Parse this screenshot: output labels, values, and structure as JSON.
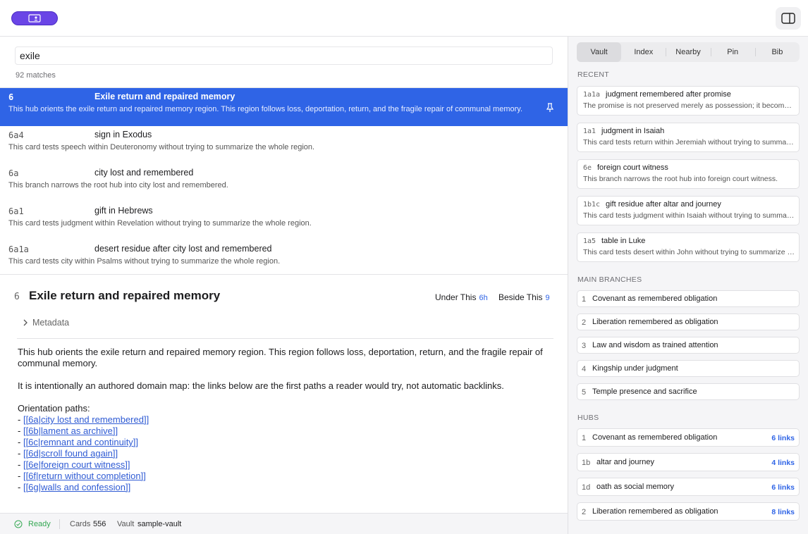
{
  "search": {
    "value": "exile",
    "match_count": "92 matches"
  },
  "results": [
    {
      "id": "6",
      "title": "Exile return and repaired memory",
      "desc": "This hub orients the exile return and repaired memory region. This region follows loss, deportation, return, and the fragile repair of communal memory.",
      "selected": true
    },
    {
      "id": "6a4",
      "title": "sign in Exodus",
      "desc": "This card tests speech within Deuteronomy without trying to summarize the whole region."
    },
    {
      "id": "6a",
      "title": "city lost and remembered",
      "desc": "This branch narrows the root hub into city lost and remembered."
    },
    {
      "id": "6a1",
      "title": "gift in Hebrews",
      "desc": "This card tests judgment within Revelation without trying to summarize the whole region."
    },
    {
      "id": "6a1a",
      "title": "desert residue after city lost and remembered",
      "desc": "This card tests city within Psalms without trying to summarize the whole region."
    }
  ],
  "detail": {
    "id": "6",
    "title": "Exile return and repaired memory",
    "under_label": "Under This",
    "under_count": "6h",
    "beside_label": "Beside This",
    "beside_count": "9",
    "metadata_label": "Metadata",
    "para1": "This hub orients the exile return and repaired memory region. This region follows loss, deportation, return, and the fragile repair of communal memory.",
    "para2": "It is intentionally an authored domain map: the links below are the first paths a reader would try, not automatic backlinks.",
    "paths_label": "Orientation paths:",
    "paths": [
      "[[6a|city lost and remembered]]",
      "[[6b|lament as archive]]",
      "[[6c|remnant and continuity]]",
      "[[6d|scroll found again]]",
      "[[6e|foreign court witness]]",
      "[[6f|return without completion]]",
      "[[6g|walls and confession]]"
    ]
  },
  "status": {
    "state": "Ready",
    "cards_label": "Cards",
    "cards_count": "556",
    "vault_label": "Vault",
    "vault_name": "sample-vault"
  },
  "sidebar": {
    "tabs": [
      "Vault",
      "Index",
      "Nearby",
      "Pin",
      "Bib"
    ],
    "active_tab": "Vault",
    "recent_label": "RECENT",
    "recent": [
      {
        "id": "1a1a",
        "title": "judgment remembered after promise",
        "desc": "The promise is not preserved merely as possession; it becomes a practice of memory."
      },
      {
        "id": "1a1",
        "title": "judgment in Isaiah",
        "desc": "This card tests return within Jeremiah without trying to summarize the whole region."
      },
      {
        "id": "6e",
        "title": "foreign court witness",
        "desc": "This branch narrows the root hub into foreign court witness."
      },
      {
        "id": "1b1c",
        "title": "gift residue after altar and journey",
        "desc": "This card tests judgment within Isaiah without trying to summarize the whole region."
      },
      {
        "id": "1a5",
        "title": "table in Luke",
        "desc": "This card tests desert within John without trying to summarize the whole region."
      }
    ],
    "branches_label": "MAIN BRANCHES",
    "branches": [
      {
        "num": "1",
        "label": "Covenant as remembered obligation"
      },
      {
        "num": "2",
        "label": "Liberation remembered as obligation"
      },
      {
        "num": "3",
        "label": "Law and wisdom as trained attention"
      },
      {
        "num": "4",
        "label": "Kingship under judgment"
      },
      {
        "num": "5",
        "label": "Temple presence and sacrifice"
      }
    ],
    "hubs_label": "HUBS",
    "hubs": [
      {
        "id": "1",
        "label": "Covenant as remembered obligation",
        "count": "6 links"
      },
      {
        "id": "1b",
        "label": "altar and journey",
        "count": "4 links"
      },
      {
        "id": "1d",
        "label": "oath as social memory",
        "count": "6 links"
      },
      {
        "id": "2",
        "label": "Liberation remembered as obligation",
        "count": "8 links"
      }
    ]
  },
  "colors": {
    "accent": "#2f64e6",
    "mode_button": "#6a45e6",
    "link": "#2f5bd4",
    "ready": "#34a853"
  },
  "icons": {
    "mode_button": "id-card-icon",
    "panel_toggle": "sidebar-toggle-icon",
    "pin": "pin-icon",
    "metadata": "chevron-right-icon",
    "status": "check-circle-icon"
  }
}
